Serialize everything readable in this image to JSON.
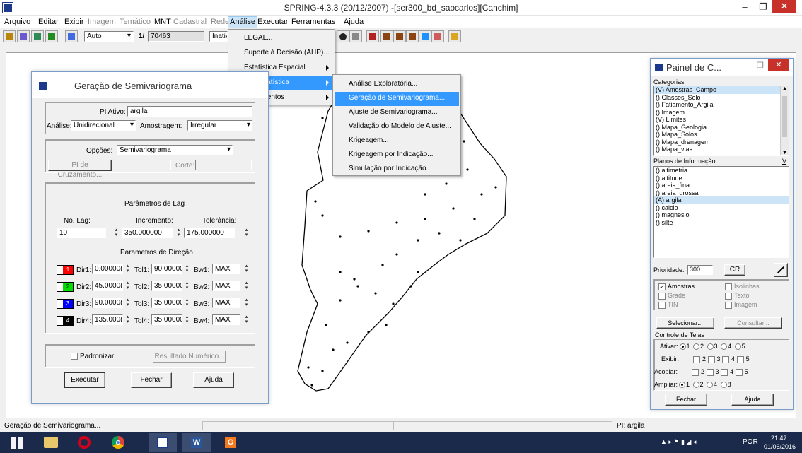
{
  "window": {
    "title": "SPRING-4.3.3 (20/12/2007) -[ser300_bd_saocarlos][Canchim]",
    "minimize": "–",
    "maximize": "❐",
    "close": "✕"
  },
  "menubar": [
    "Arquivo",
    "Editar",
    "Exibir",
    "Imagem",
    "Temático",
    "MNT",
    "Cadastral",
    "Rede",
    "Análise",
    "Executar",
    "Ferramentas",
    "Ajuda"
  ],
  "toolbar": {
    "mode_select": "Auto",
    "scale_label": "1/",
    "scale_value": "70463",
    "status_select": "Inativ"
  },
  "analise_menu": {
    "items": [
      "LEGAL...",
      "Suporte à Decisão (AHP)...",
      "Estatística Espacial",
      "Geoestatística",
      "Lineamentos"
    ]
  },
  "geo_menu": {
    "items": [
      "Análise Exploratória...",
      "Geração de Semivariograma...",
      "Ajuste de Semivariograma...",
      "Validação do Modelo de Ajuste...",
      "Krigeagem...",
      "Krigeagem por Indicação...",
      "Simulação por Indicação..."
    ]
  },
  "dialog": {
    "title": "Geração de Semivariograma",
    "minimize": "–",
    "pi_ativo_label": "PI Ativo:",
    "pi_ativo_value": "argila",
    "analise_label": "Análise:",
    "analise_value": "Unidirecional",
    "amostragem_label": "Amostragem:",
    "amostragem_value": "Irregular",
    "opcoes_label": "Opções:",
    "opcoes_value": "Semivariograma",
    "pi_cruzamento_button": "PI de Cruzamento...",
    "corte_label": "Corte:",
    "lag_title": "Parâmetros de Lag",
    "nolag_label": "No. Lag:",
    "nolag_value": "10",
    "incremento_label": "Incremento:",
    "incremento_value": "350.000000",
    "tolerancia_label": "Tolerância:",
    "tolerancia_value": "175.000000",
    "direcao_title": "Parametros de Direção",
    "directions": [
      {
        "num": "1",
        "color": "#ff0000",
        "dir_label": "Dir1:",
        "dir": "0.00000(",
        "tol_label": "Tol1:",
        "tol": "90.00000",
        "bw_label": "Bw1:",
        "bw": "MAX"
      },
      {
        "num": "2",
        "color": "#00dd00",
        "dir_label": "Dir2:",
        "dir": "45.0000(",
        "tol_label": "Tol2:",
        "tol": "35.00000",
        "bw_label": "Bw2:",
        "bw": "MAX"
      },
      {
        "num": "3",
        "color": "#0000ff",
        "dir_label": "Dir3:",
        "dir": "90.0000(",
        "tol_label": "Tol3:",
        "tol": "35.00000",
        "bw_label": "Bw3:",
        "bw": "MAX"
      },
      {
        "num": "4",
        "color": "#000000",
        "dir_label": "Dir4:",
        "dir": "135.000(",
        "tol_label": "Tol4:",
        "tol": "35.00000",
        "bw_label": "Bw4:",
        "bw": "MAX"
      }
    ],
    "padronizar_label": "Padronizar",
    "resultado_button": "Resultado Numérico...",
    "executar_button": "Executar",
    "fechar_button": "Fechar",
    "ajuda_button": "Ajuda"
  },
  "panel": {
    "title": "Painel de C...",
    "categorias_label": "Categorias",
    "categorias": [
      "(V) Amostras_Campo",
      "() Classes_Solo",
      "() Fatiamento_Argila",
      "() Imagem",
      "(V) Limites",
      "() Mapa_Geologia",
      "() Mapa_Solos",
      "() Mapa_drenagem",
      "() Mapa_vias"
    ],
    "planos_label": "Planos de Informação",
    "planos_v": "V",
    "planos": [
      "() altimetria",
      "() altitude",
      "() areia_fina",
      "() areia_grossa",
      "(A) argila",
      "() calcio",
      "() magnesio",
      "() silte"
    ],
    "prioridade_label": "Prioridade:",
    "prioridade_value": "300",
    "cr_button": "CR",
    "amostras": "Amostras",
    "isolinhas": "Isolinhas",
    "grade": "Grade",
    "texto": "Texto",
    "tin": "TIN",
    "imagem": "Imagem",
    "selecionar_button": "Selecionar...",
    "consultar_button": "Consultar...",
    "controle_label": "Controle de Telas",
    "ativar_label": "Ativar:",
    "exibir_label": "Exibir:",
    "acoplar_label": "Acoplar:",
    "ampliar_label": "Ampliar:",
    "nums": [
      "1",
      "2",
      "3",
      "4",
      "5"
    ],
    "ampliar_nums": [
      "1",
      "2",
      "4",
      "8"
    ],
    "fechar_button": "Fechar",
    "ajuda_button": "Ajuda"
  },
  "statusbar": {
    "left": "Geração de Semivariograma...",
    "right": "PI: argila"
  },
  "taskbar": {
    "lang": "POR",
    "time": "21:47",
    "date": "01/06/2016"
  }
}
